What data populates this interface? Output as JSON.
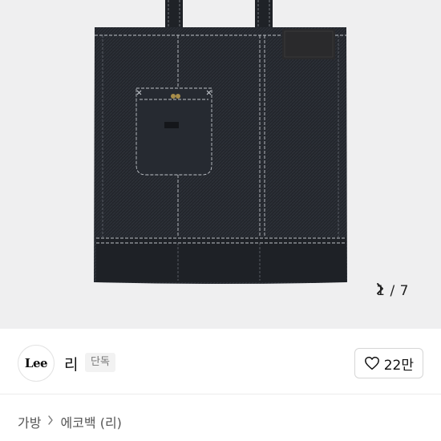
{
  "gallery": {
    "current": "1",
    "separator": "/",
    "total": "7",
    "product_image": "denim-tote-bag",
    "colors": {
      "background": "#efeff0",
      "denim": "#23262c",
      "stitch": "#bfc3c8",
      "leather": "#2a2a2c"
    }
  },
  "brand": {
    "logo_text": "Lee",
    "name": "리",
    "badge": "단독"
  },
  "like": {
    "icon": "heart-icon",
    "count": "22만"
  },
  "breadcrumb": {
    "items": [
      "가방",
      "에코백 (리)"
    ],
    "separator_icon": "chevron-right-icon"
  }
}
